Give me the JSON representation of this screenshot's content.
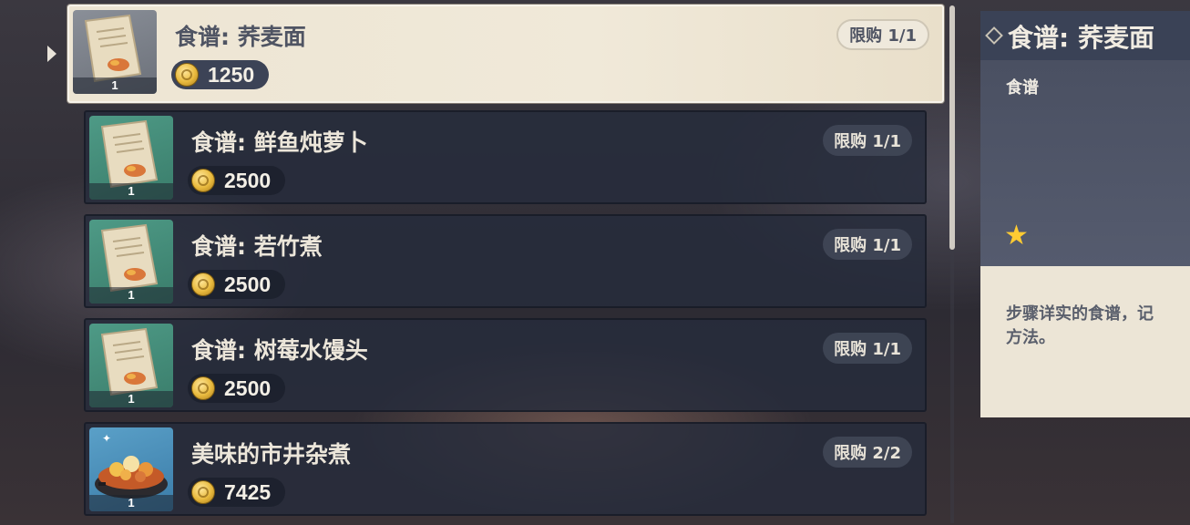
{
  "shop": {
    "items": [
      {
        "title": "食谱: 荞麦面",
        "price": "1250",
        "limit": "限购 1/1",
        "qty": "1",
        "icon": "recipe-scroll-icon",
        "selected": true
      },
      {
        "title": "食谱: 鲜鱼炖萝卜",
        "price": "2500",
        "limit": "限购 1/1",
        "qty": "1",
        "icon": "recipe-scroll-icon"
      },
      {
        "title": "食谱: 若竹煮",
        "price": "2500",
        "limit": "限购 1/1",
        "qty": "1",
        "icon": "recipe-scroll-icon"
      },
      {
        "title": "食谱: 树莓水馒头",
        "price": "2500",
        "limit": "限购 1/1",
        "qty": "1",
        "icon": "recipe-scroll-icon"
      },
      {
        "title": "美味的市井杂煮",
        "price": "7425",
        "limit": "限购 2/2",
        "qty": "1",
        "icon": "hotpot-dish-icon"
      }
    ],
    "currency_icon": "mora-coin-icon"
  },
  "detail": {
    "title": "食谱: 荞麦面",
    "type": "食谱",
    "rarity_stars": 1,
    "description": "步骤详实的食谱，记\n方法。"
  },
  "colors": {
    "star": "#ffcb32",
    "selected_bg": "#ede5d3",
    "row_bg": "#262c3c"
  }
}
